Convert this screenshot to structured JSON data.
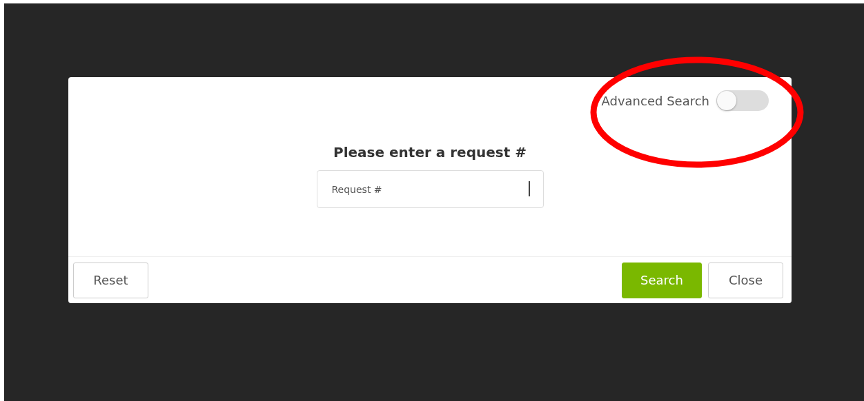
{
  "advanced_search": {
    "label": "Advanced Search",
    "on": false
  },
  "heading": "Please enter a request #",
  "request_field": {
    "placeholder": "Request #"
  },
  "footer_left": [
    {
      "label": "Reset",
      "kind": "secondary"
    }
  ],
  "footer_right": [
    {
      "label": "Search",
      "kind": "primary"
    },
    {
      "label": "Close",
      "kind": "secondary"
    }
  ]
}
